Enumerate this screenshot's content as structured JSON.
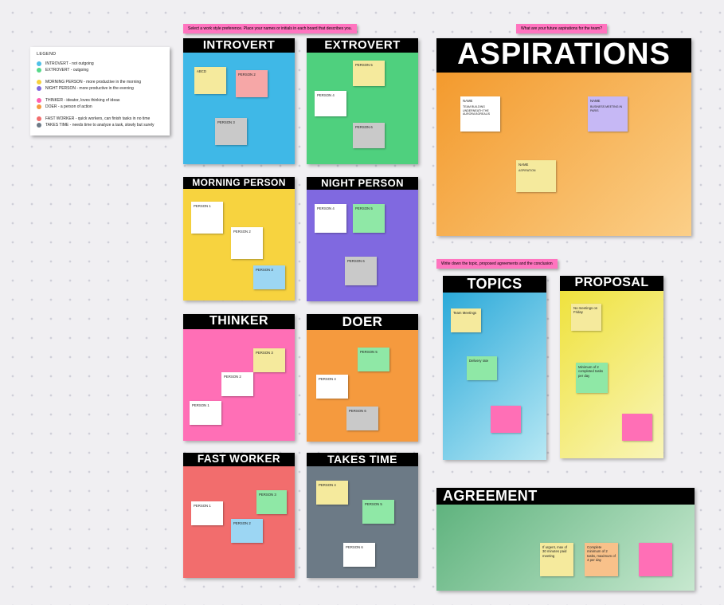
{
  "legend": {
    "title": "LEGEND",
    "items": [
      {
        "color": "#4fc0e8",
        "text": "INTROVERT - not outgoing"
      },
      {
        "color": "#57d98a",
        "text": "EXTROVERT - outgoing"
      },
      {
        "sep": true
      },
      {
        "color": "#f7d13d",
        "text": "MORNING PERSON - more productive in the morning"
      },
      {
        "color": "#8069e0",
        "text": "NIGHT PERSON - more productive in the evening"
      },
      {
        "sep": true
      },
      {
        "color": "#ff5fb0",
        "text": "THINKER - ideator, loves thinking of ideas"
      },
      {
        "color": "#f59a3e",
        "text": "DOER - a person of action"
      },
      {
        "sep": true
      },
      {
        "color": "#f26d6d",
        "text": "FAST WORKER - quick workers, can finish tasks in no time"
      },
      {
        "color": "#6c7a86",
        "text": "TAKES TIME - needs time to analyze a task, slowly but surely"
      }
    ]
  },
  "banners": {
    "b1": "Select a work style preference. Place your names or initials in each board that describes you.",
    "b2": "What are your future aspirations for the team?",
    "b3": "Write down the topic, proposed agreements and the conclusion"
  },
  "boards": {
    "introvert": {
      "title": "INTROVERT",
      "notes": {
        "n1": "ABCD",
        "n2": "PERSON 2",
        "n3": "PERSON 3"
      }
    },
    "extrovert": {
      "title": "EXTROVERT",
      "notes": {
        "n1": "PERSON 5",
        "n2": "PERSON 4",
        "n3": "PERSON 6"
      }
    },
    "morning": {
      "title": "MORNING PERSON",
      "notes": {
        "n1": "PERSON 1",
        "n2": "PERSON 2",
        "n3": "PERSON 3"
      }
    },
    "night": {
      "title": "NIGHT PERSON",
      "notes": {
        "n1": "PERSON 4",
        "n2": "PERSON 5",
        "n3": "PERSON 6"
      }
    },
    "thinker": {
      "title": "THINKER",
      "notes": {
        "n1": "PERSON 1",
        "n2": "PERSON 2",
        "n3": "PERSON 3"
      }
    },
    "doer": {
      "title": "DOER",
      "notes": {
        "n1": "PERSON 4",
        "n2": "PERSON 5",
        "n3": "PERSON 6"
      }
    },
    "fast": {
      "title": "FAST WORKER",
      "notes": {
        "n1": "PERSON 1",
        "n2": "PERSON 2",
        "n3": "PERSON 3"
      }
    },
    "takestime": {
      "title": "TAKES TIME",
      "notes": {
        "n1": "PERSON 4",
        "n2": "PERSON 5",
        "n3": "PERSON 6"
      }
    },
    "aspirations": {
      "title": "ASPIRATIONS",
      "notes": {
        "c1_name": "NAME",
        "c1_body": "TEAM BUILDING UNDERNEATH THE AURORA BOREALIS",
        "c2_name": "NAME",
        "c2_body": "BUSINESS MEETING IN PARIS",
        "c3_name": "NAME",
        "c3_body": "ASPIRATION"
      }
    },
    "topics": {
      "title": "TOPICS",
      "notes": {
        "n1": "Team Meetings",
        "n2": "Delivery rate"
      }
    },
    "proposal": {
      "title": "PROPOSAL",
      "notes": {
        "n1": "No meetings on Friday",
        "n2": "Minimum of 2 completed tasks per day"
      }
    },
    "agreement": {
      "title": "AGREEMENT",
      "notes": {
        "n1": "If urgent, max of 30 minutes paid meeting",
        "n2": "Complete minimum of 2 tasks, maximum of 4 per day"
      }
    }
  }
}
